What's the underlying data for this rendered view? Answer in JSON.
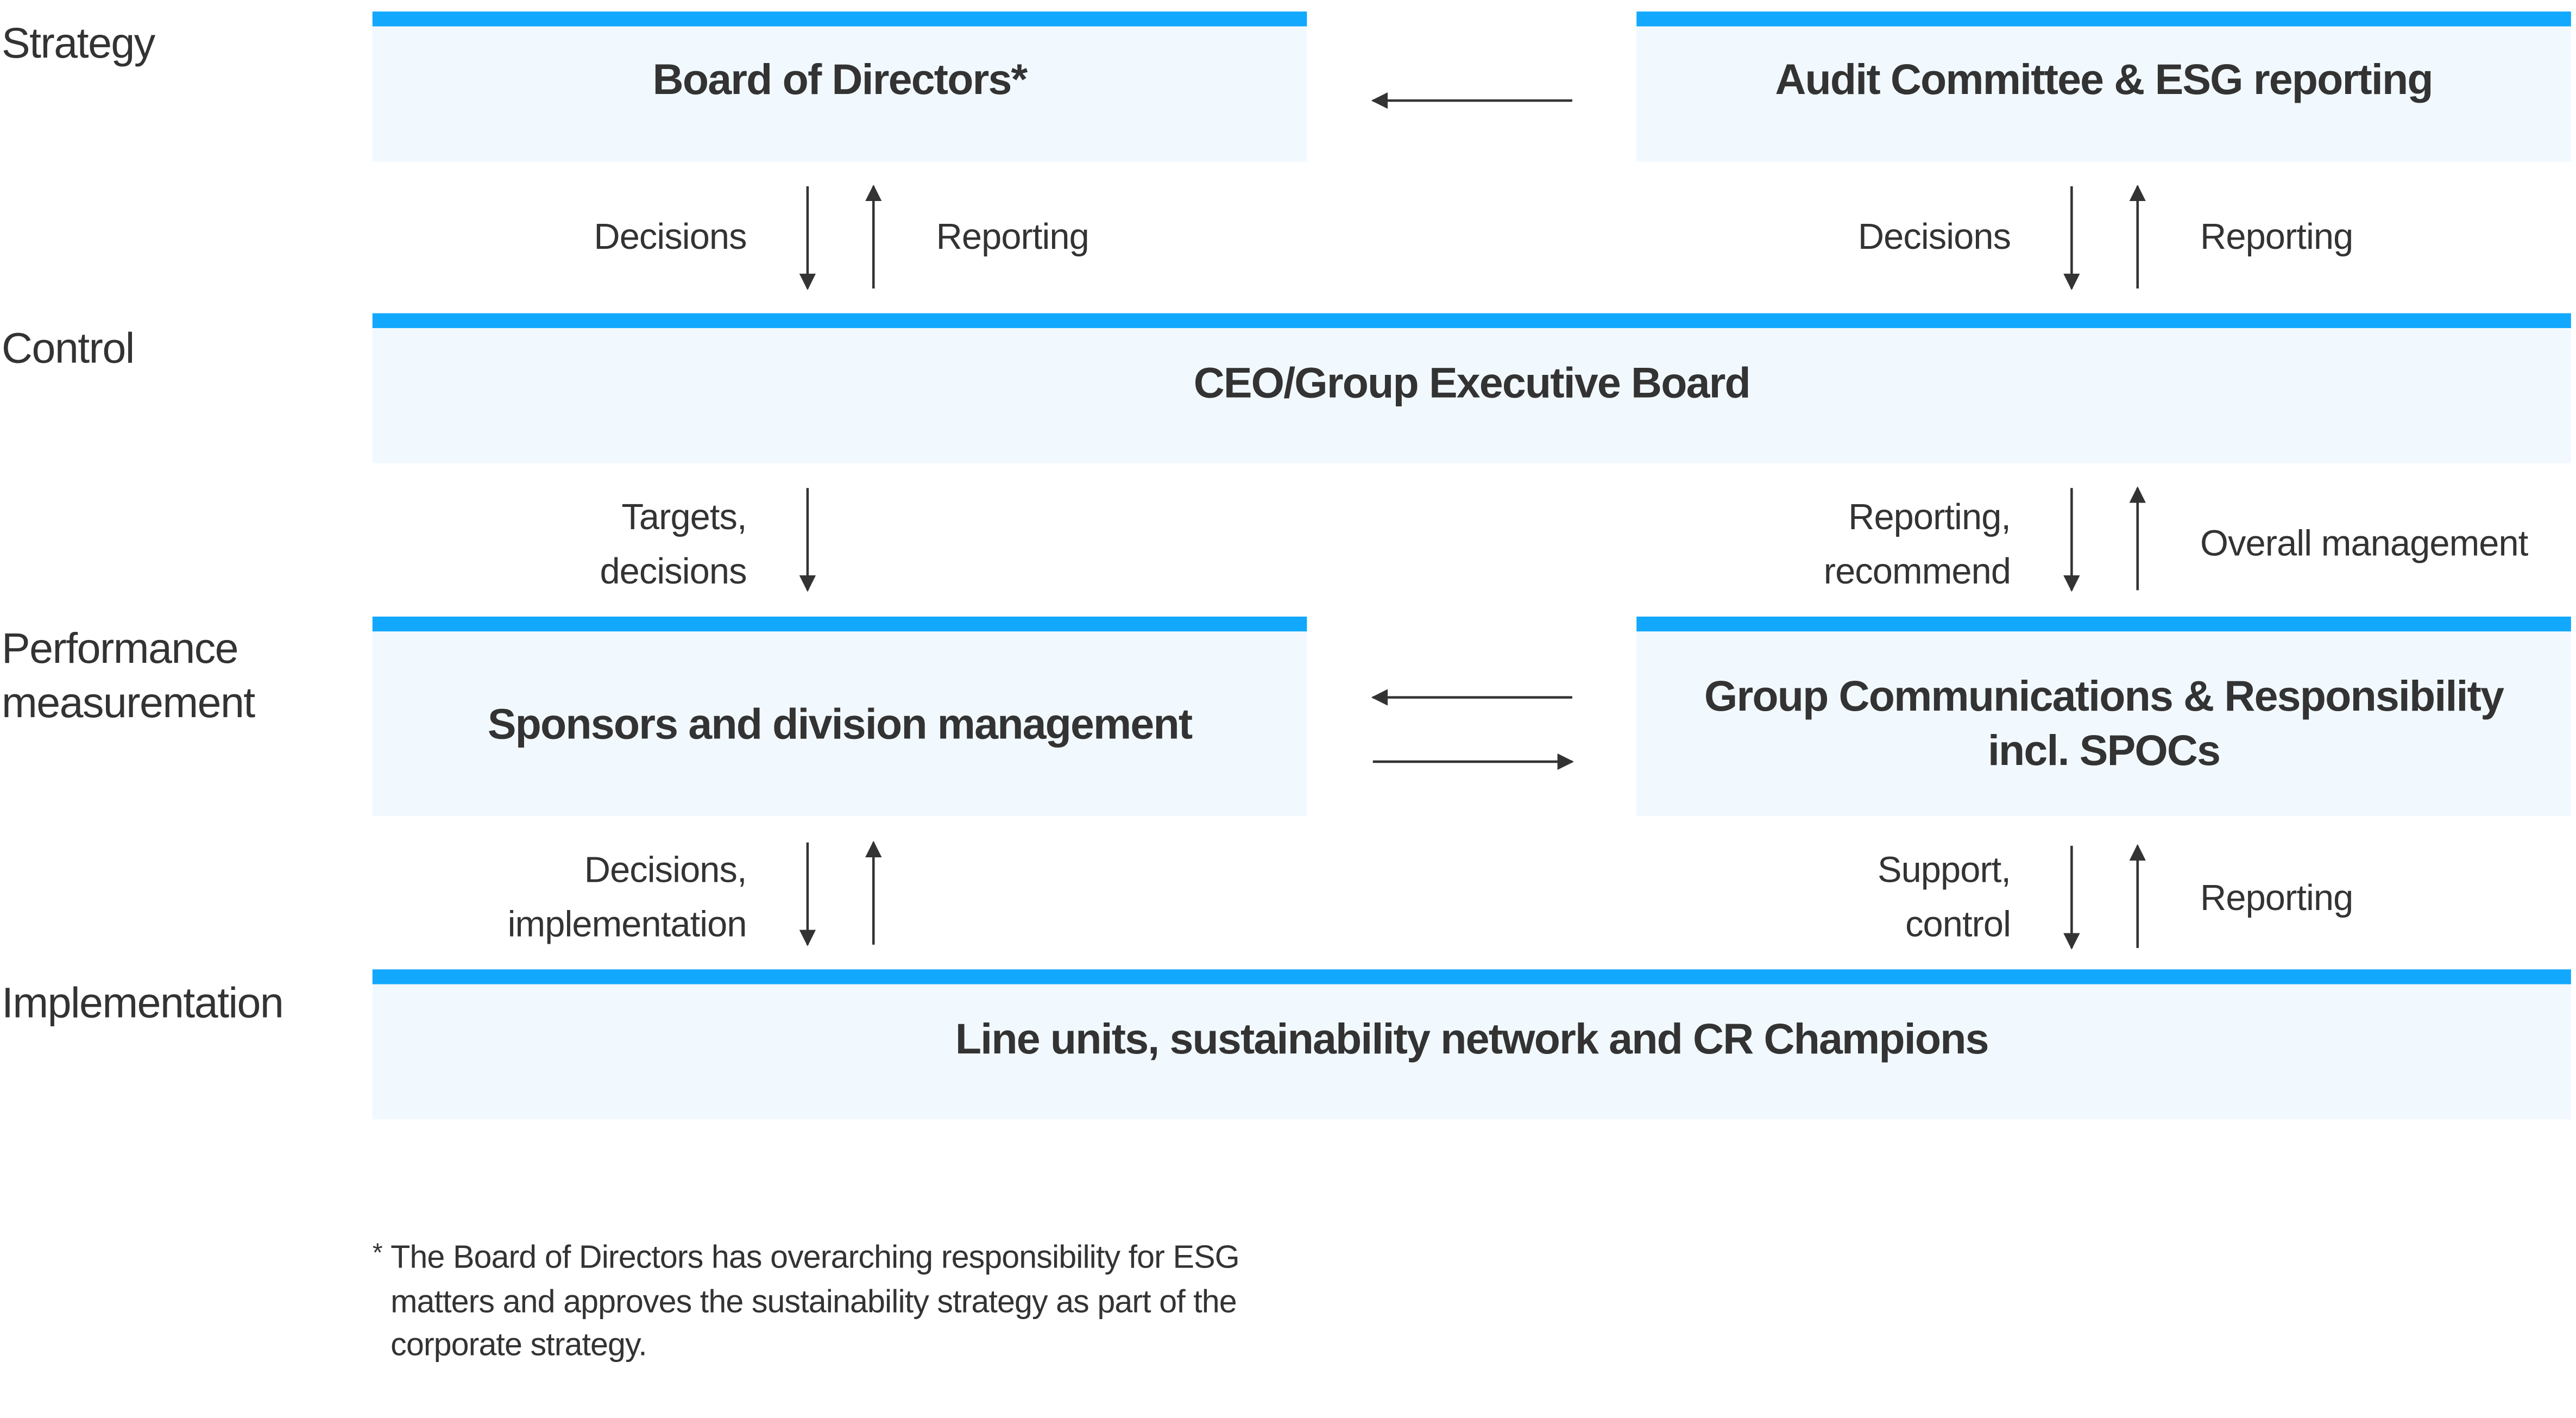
{
  "colors": {
    "accent_bar": "#12a8fd",
    "box_fill": "#f2f9fe",
    "text": "#333333",
    "arrow": "#333333"
  },
  "levels": [
    {
      "id": "strategy",
      "label": "Strategy"
    },
    {
      "id": "control",
      "label": "Control"
    },
    {
      "id": "performance",
      "label": "Performance measurement",
      "lines": [
        "Performance",
        "measurement"
      ]
    },
    {
      "id": "implementation",
      "label": "Implementation"
    }
  ],
  "boxes": {
    "board": "Board of Directors*",
    "audit": "Audit Committee & ESG reporting",
    "ceo": "CEO/Group Executive Board",
    "sponsors": "Sponsors and division management",
    "group_comm": {
      "line1": "Group Communications & Responsibility",
      "line2": "incl. SPOCs"
    },
    "line_units": "Line units, sustainability network and CR Champions"
  },
  "flows": {
    "board_ceo": {
      "down": "Decisions",
      "up": "Reporting"
    },
    "audit_ceo": {
      "down": "Decisions",
      "up": "Reporting"
    },
    "ceo_sponsors": {
      "down": [
        "Targets,",
        "decisions"
      ]
    },
    "ceo_groupcomm": {
      "down": [
        "Reporting,",
        "recommend"
      ],
      "up": "Overall management"
    },
    "sponsors_line": {
      "down": [
        "Decisions,",
        "implementation"
      ]
    },
    "groupcomm_line": {
      "down": [
        "Support,",
        "control"
      ],
      "up": "Reporting"
    }
  },
  "horizontal_arrows": [
    {
      "from": "audit",
      "to": "board",
      "direction": "left"
    },
    {
      "from": "group_comm",
      "to": "sponsors",
      "direction": "left"
    },
    {
      "from": "sponsors",
      "to": "group_comm",
      "direction": "right"
    }
  ],
  "footnote": {
    "marker": "*",
    "lines": [
      "The Board of Directors has overarching responsibility for ESG",
      "matters and approves the sustainability strategy as part of the",
      "corporate strategy."
    ]
  }
}
